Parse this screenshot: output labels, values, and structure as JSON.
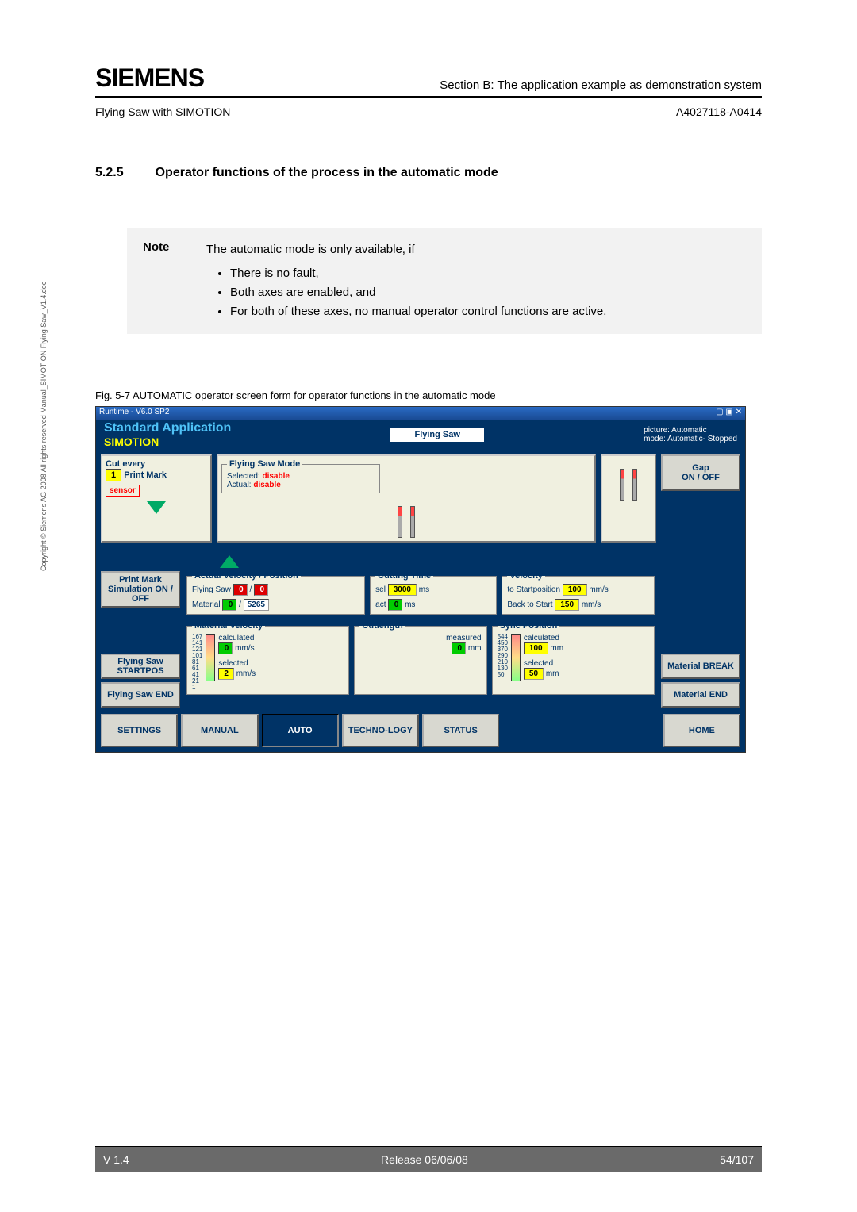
{
  "header": {
    "logo": "SIEMENS",
    "section": "Section B:  The application example as demonstration system",
    "doc_left": "Flying Saw with SIMOTION",
    "doc_right": "A4027118-A0414"
  },
  "section": {
    "number": "5.2.5",
    "title": "Operator functions of the process in the automatic mode"
  },
  "note": {
    "label": "Note",
    "intro": "The automatic mode is only available, if",
    "bullets": [
      "There is no fault,",
      "Both axes are enabled, and",
      "For both of these axes, no manual operator control functions are active."
    ]
  },
  "figure": {
    "caption": "Fig. 5-7 AUTOMATIC operator screen form for operator functions in the automatic mode"
  },
  "copyright": "Copyright © Siemens AG 2008 All rights reserved    Manual_SIMOTION Flying Saw_V1.4.doc",
  "hmi": {
    "titlebar": "Runtime - V6.0 SP2",
    "app": "Standard Application",
    "product": "SIMOTION",
    "center": "Flying Saw",
    "picture": "picture: Automatic",
    "mode": "mode: Automatic- Stopped",
    "cut_every_label": "Cut every",
    "cut_every_value": "1",
    "print_mark": "Print Mark",
    "sensor": "sensor",
    "fsmode_title": "Flying Saw Mode",
    "selected_label": "Selected:",
    "actual_label": "Actual:",
    "disable": "disable",
    "gap_label": "Gap",
    "onoff": "ON / OFF",
    "pm_sim": "Print Mark Simulation ON / OFF",
    "avp_title": "Actual Velocity / Position",
    "flying_saw": "Flying Saw",
    "material": "Material",
    "avp_fs_v": "0",
    "avp_fs_p": "0",
    "avp_mat_v": "0",
    "avp_mat_p": "5265",
    "cutting_time_title": "Cutting Time",
    "ct_sel": "sel",
    "ct_sel_val": "3000",
    "ct_sel_unit": "ms",
    "ct_act": "act",
    "ct_act_val": "0",
    "ct_act_unit": "ms",
    "velocity_title": "Velocity",
    "to_start": "to Startposition",
    "to_start_val": "100",
    "mms": "mm/s",
    "back_start": "Back to Start",
    "back_start_val": "150",
    "mv_title": "Material Velocity",
    "mv_calc": "calculated",
    "mv_calc_val": "0",
    "mv_calc_unit": "mm/s",
    "mv_sel": "selected",
    "mv_sel_val": "2",
    "mv_sel_unit": "mm/s",
    "mv_ticks": [
      "167",
      "141",
      "121",
      "101",
      "81",
      "61",
      "41",
      "21",
      "1"
    ],
    "cl_title": "Cutlength",
    "cl_meas": "measured",
    "cl_meas_val": "0",
    "cl_meas_unit": "mm",
    "sp_title": "Sync Position",
    "sp_calc": "calculated",
    "sp_calc_val": "100",
    "sp_calc_unit": "mm",
    "sp_sel": "selected",
    "sp_sel_val": "50",
    "sp_sel_unit": "mm",
    "sp_ticks": [
      "544",
      "450",
      "370",
      "290",
      "210",
      "130",
      "50"
    ],
    "btn_fs_start": "Flying Saw STARTPOS",
    "btn_fs_end": "Flying Saw END",
    "btn_mat_break": "Material BREAK",
    "btn_mat_end": "Material END",
    "bottom": {
      "settings": "SETTINGS",
      "manual": "MANUAL",
      "auto": "AUTO",
      "tech": "TECHNO-LOGY",
      "status": "STATUS",
      "home": "HOME"
    }
  },
  "footer": {
    "version": "V 1.4",
    "release": "Release 06/06/08",
    "page": "54/107"
  }
}
